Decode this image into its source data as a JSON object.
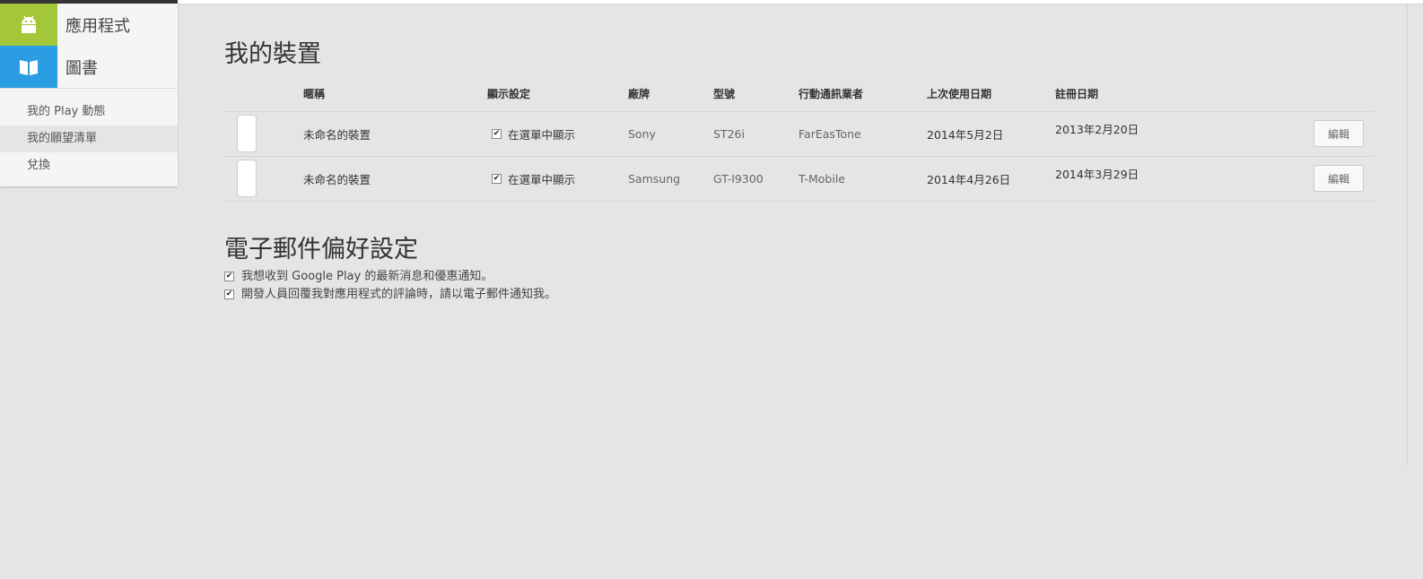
{
  "sidebar": {
    "categories": [
      {
        "label": "應用程式",
        "icon": "android-icon",
        "color": "#a4c639"
      },
      {
        "label": "圖書",
        "icon": "book-icon",
        "color": "#2a9de3"
      }
    ],
    "links": [
      {
        "label": "我的 Play 動態"
      },
      {
        "label": "我的願望清單"
      },
      {
        "label": "兌換"
      }
    ]
  },
  "devices": {
    "title": "我的裝置",
    "headers": [
      "暱稱",
      "顯示設定",
      "廠牌",
      "型號",
      "行動通訊業者",
      "上次使用日期",
      "註冊日期"
    ],
    "rows": [
      {
        "nickname": "未命名的裝置",
        "show_label": "在選單中顯示",
        "brand": "Sony",
        "model": "ST26i",
        "carrier": "FarEasTone",
        "last_used": "2014年5月2日",
        "registered": "2013年2月20日",
        "edit_label": "編輯"
      },
      {
        "nickname": "未命名的裝置",
        "show_label": "在選單中顯示",
        "brand": "Samsung",
        "model": "GT-I9300",
        "carrier": "T-Mobile",
        "last_used": "2014年4月26日",
        "registered": "2014年3月29日",
        "edit_label": "編輯"
      }
    ]
  },
  "email_prefs": {
    "title": "電子郵件偏好設定",
    "options": [
      {
        "label": "我想收到 Google Play 的最新消息和優惠通知。",
        "checked": true
      },
      {
        "label": "開發人員回覆我對應用程式的評論時，請以電子郵件通知我。",
        "checked": true
      }
    ]
  }
}
